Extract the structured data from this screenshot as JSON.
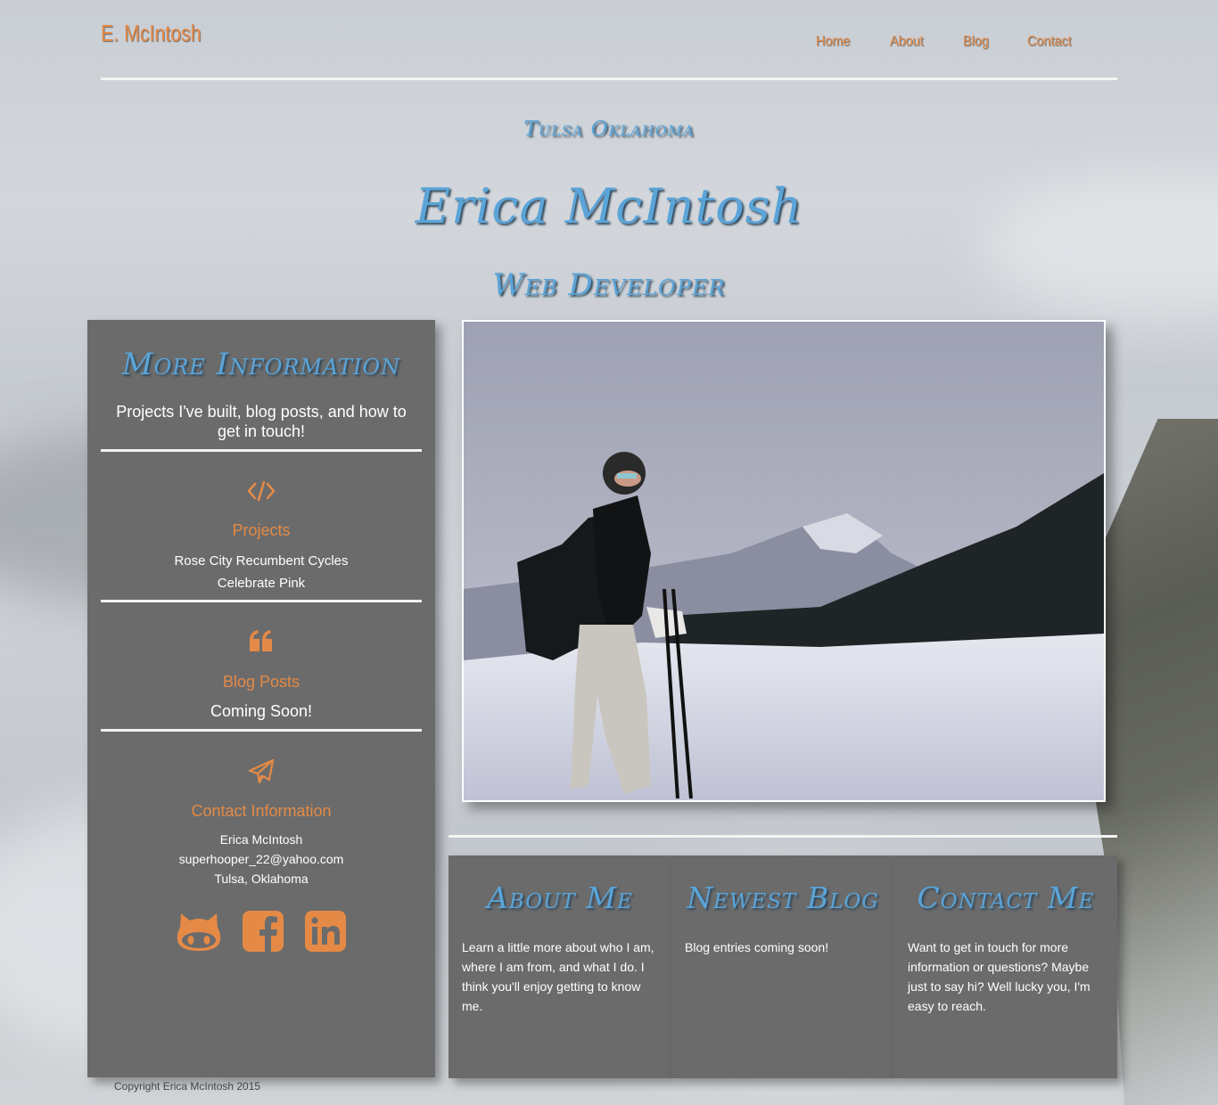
{
  "header": {
    "logo": "E. McIntosh",
    "nav": [
      "Home",
      "About",
      "Blog",
      "Contact"
    ]
  },
  "hero": {
    "location": "Tulsa Oklahoma",
    "name": "Erica McIntosh",
    "role": "Web Developer"
  },
  "sidebar": {
    "title": "More Information",
    "intro": "Projects I've built, blog posts, and how to get in touch!",
    "projects": {
      "icon": "code-icon",
      "heading": "Projects",
      "items": [
        "Rose City Recumbent Cycles",
        "Celebrate Pink"
      ]
    },
    "blog": {
      "icon": "quote-icon",
      "heading": "Blog Posts",
      "text": "Coming Soon!"
    },
    "contact": {
      "icon": "paper-plane-icon",
      "heading": "Contact Information",
      "name": "Erica McIntosh",
      "email": "superhooper_22@yahoo.com",
      "location": "Tulsa, Oklahoma"
    },
    "social": [
      "github-icon",
      "facebook-icon",
      "linkedin-icon"
    ]
  },
  "panels": [
    {
      "title": "About Me",
      "body": "Learn a little more about who I am, where I am from, and what I do. I think you'll enjoy getting to know me."
    },
    {
      "title": "Newest Blog",
      "body": "Blog entries coming soon!"
    },
    {
      "title": "Contact Me",
      "body": "Want to get in touch for more information or questions? Maybe just to say hi? Well lucky you, I'm easy to reach."
    }
  ],
  "footer": {
    "copyright": "Copyright Erica McIntosh 2015"
  },
  "colors": {
    "accent": "#e58a46",
    "script": "#5aa4d8",
    "panel": "#6b6b6b"
  }
}
